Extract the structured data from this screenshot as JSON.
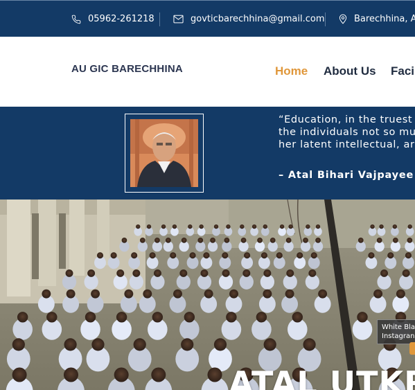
{
  "contact_bar": {
    "phone": "05962-261218",
    "email": "govticbarechhina@gmail.com",
    "address": "Barechhina, A",
    "phone_icon": "phone-icon",
    "email_icon": "mail-icon",
    "address_icon": "map-pin-icon"
  },
  "header": {
    "logo_text": "AU GIC BARECHHINA",
    "nav": [
      {
        "label": "Home",
        "active": true
      },
      {
        "label": "About Us",
        "active": false
      },
      {
        "label": "Faci",
        "active": false
      }
    ]
  },
  "quote_section": {
    "quote_lines": [
      "“Education, in the truest",
      "the individuals not so mu",
      "her latent intellectual, ar"
    ],
    "author": "– Atal Bihari Vajpayee"
  },
  "hero": {
    "title": "ATAL UTKR",
    "social_tooltip": [
      "White Bla",
      "Instagran"
    ]
  },
  "colors": {
    "navy": "#133a66",
    "accent": "#e0973a",
    "nav_text": "#1f2b3f",
    "white": "#ffffff"
  }
}
